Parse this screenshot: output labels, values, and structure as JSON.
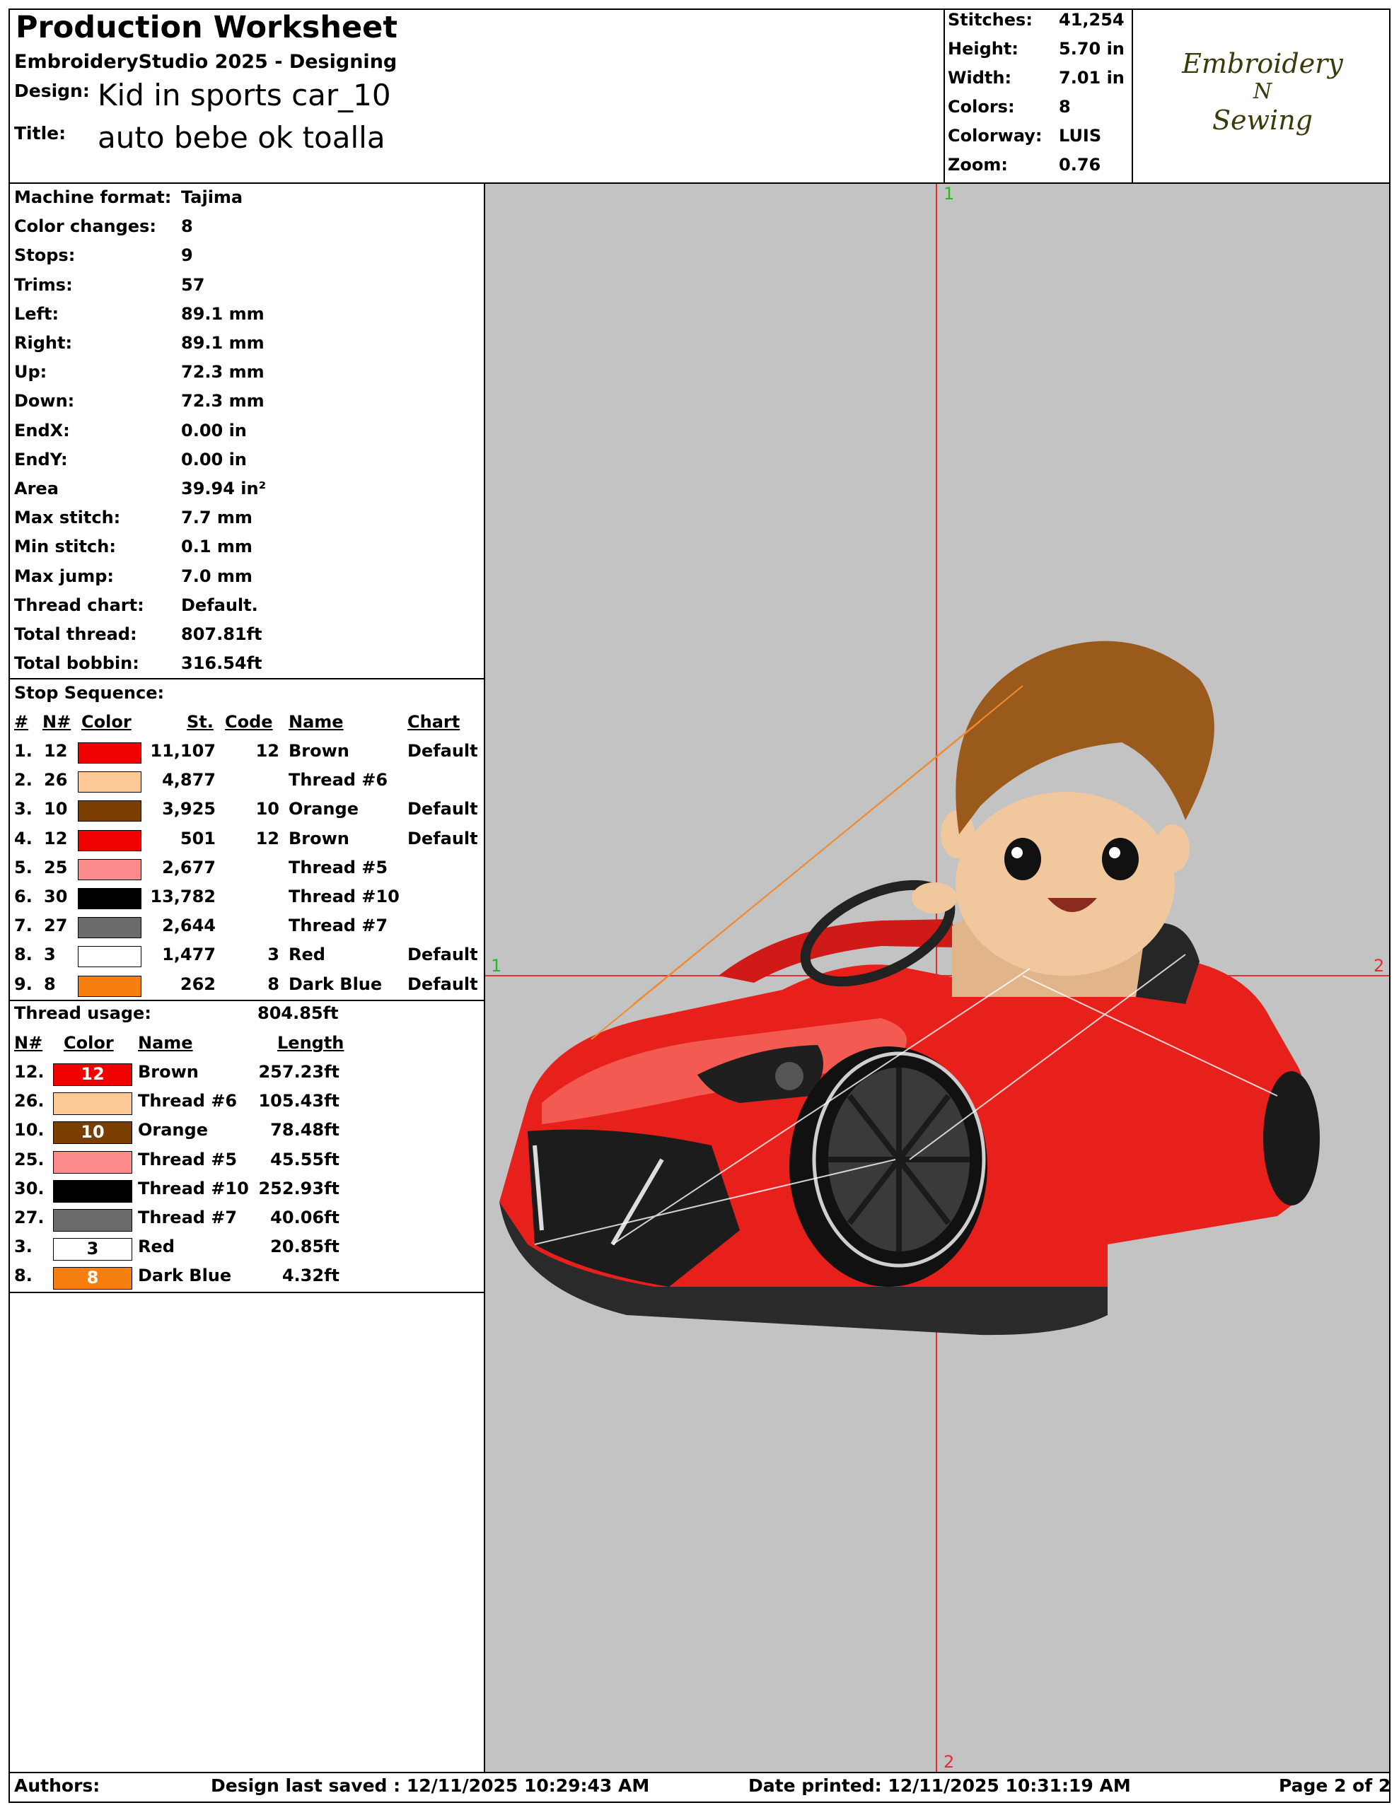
{
  "header": {
    "title": "Production Worksheet",
    "app": "EmbroideryStudio 2025 - Designing",
    "design_label": "Design:",
    "design_value": "Kid in sports car_10",
    "title_label": "Title:",
    "title_value": "auto bebe ok toalla"
  },
  "summary": [
    {
      "label": "Stitches:",
      "value": "41,254"
    },
    {
      "label": "Height:",
      "value": "5.70 in"
    },
    {
      "label": "Width:",
      "value": "7.01 in"
    },
    {
      "label": "Colors:",
      "value": "8"
    },
    {
      "label": "Colorway:",
      "value": "LUIS"
    },
    {
      "label": "Zoom:",
      "value": "0.76"
    }
  ],
  "logo": {
    "line1": "Embroidery",
    "line2": "N",
    "line3": "Sewing"
  },
  "info": [
    {
      "label": "Machine format:",
      "value": "Tajima"
    },
    {
      "label": "Color changes:",
      "value": "8"
    },
    {
      "label": "Stops:",
      "value": "9"
    },
    {
      "label": "Trims:",
      "value": "57"
    },
    {
      "label": "Left:",
      "value": "89.1 mm"
    },
    {
      "label": "Right:",
      "value": "89.1 mm"
    },
    {
      "label": "Up:",
      "value": "72.3 mm"
    },
    {
      "label": "Down:",
      "value": "72.3 mm"
    },
    {
      "label": "EndX:",
      "value": "0.00 in"
    },
    {
      "label": "EndY:",
      "value": "0.00 in"
    },
    {
      "label": "Area",
      "value": " 39.94 in²"
    },
    {
      "label": "Max stitch:",
      "value": "7.7 mm"
    },
    {
      "label": "Min stitch:",
      "value": "0.1 mm"
    },
    {
      "label": "Max jump:",
      "value": "7.0 mm"
    },
    {
      "label": "Thread chart:",
      "value": "Default."
    },
    {
      "label": "Total thread:",
      "value": "807.81ft"
    },
    {
      "label": "Total bobbin:",
      "value": "316.54ft"
    }
  ],
  "stop_sequence": {
    "title": "Stop Sequence:",
    "headers": {
      "idx": "#",
      "n": "N#",
      "color": "Color",
      "st": "St.",
      "code": "Code",
      "name": "Name",
      "chart": "Chart"
    },
    "rows": [
      {
        "idx": "1.",
        "n": "12",
        "color": "#f00000",
        "st": "11,107",
        "code": "12",
        "name": "Brown",
        "chart": "Default"
      },
      {
        "idx": "2.",
        "n": "26",
        "color": "#fcc896",
        "st": "4,877",
        "code": "",
        "name": "Thread #6",
        "chart": ""
      },
      {
        "idx": "3.",
        "n": "10",
        "color": "#7a3e00",
        "st": "3,925",
        "code": "10",
        "name": "Orange",
        "chart": "Default"
      },
      {
        "idx": "4.",
        "n": "12",
        "color": "#f00000",
        "st": "501",
        "code": "12",
        "name": "Brown",
        "chart": "Default"
      },
      {
        "idx": "5.",
        "n": "25",
        "color": "#fb8a8a",
        "st": "2,677",
        "code": "",
        "name": "Thread #5",
        "chart": ""
      },
      {
        "idx": "6.",
        "n": "30",
        "color": "#000000",
        "st": "13,782",
        "code": "",
        "name": "Thread #10",
        "chart": ""
      },
      {
        "idx": "7.",
        "n": "27",
        "color": "#6b6b6b",
        "st": "2,644",
        "code": "",
        "name": "Thread #7",
        "chart": ""
      },
      {
        "idx": "8.",
        "n": "3",
        "color": "#ffffff",
        "st": "1,477",
        "code": "3",
        "name": "Red",
        "chart": "Default"
      },
      {
        "idx": "9.",
        "n": "8",
        "color": "#f77f10",
        "st": "262",
        "code": "8",
        "name": "Dark Blue",
        "chart": "Default"
      }
    ]
  },
  "thread_usage": {
    "title": "Thread usage:",
    "total": "804.85ft",
    "headers": {
      "n": "N#",
      "color": "Color",
      "name": "Name",
      "length": "Length"
    },
    "rows": [
      {
        "n": "12.",
        "color": "#f00000",
        "num": "12",
        "text_color": "#ffffff",
        "name": "Brown",
        "length": "257.23ft"
      },
      {
        "n": "26.",
        "color": "#fcc896",
        "num": "",
        "text_color": "#000000",
        "name": "Thread #6",
        "length": "105.43ft"
      },
      {
        "n": "10.",
        "color": "#7a3e00",
        "num": "10",
        "text_color": "#ffffff",
        "name": "Orange",
        "length": "78.48ft"
      },
      {
        "n": "25.",
        "color": "#fb8a8a",
        "num": "",
        "text_color": "#000000",
        "name": "Thread #5",
        "length": "45.55ft"
      },
      {
        "n": "30.",
        "color": "#000000",
        "num": "",
        "text_color": "#ffffff",
        "name": "Thread #10",
        "length": "252.93ft"
      },
      {
        "n": "27.",
        "color": "#6b6b6b",
        "num": "",
        "text_color": "#ffffff",
        "name": "Thread #7",
        "length": "40.06ft"
      },
      {
        "n": "3.",
        "color": "#ffffff",
        "num": "3",
        "text_color": "#000000",
        "name": "Red",
        "length": "20.85ft"
      },
      {
        "n": "8.",
        "color": "#f77f10",
        "num": "8",
        "text_color": "#ffffff",
        "name": "Dark Blue",
        "length": "4.32ft"
      }
    ]
  },
  "preview": {
    "background": "#c3c3c3",
    "axis_color": "#e03030",
    "marker_color": "#22bb22",
    "marker_1": "1",
    "marker_2": "2"
  },
  "footer": {
    "authors": "Authors:",
    "saved": "Design last saved : 12/11/2025 10:29:43 AM",
    "printed": "Date printed: 12/11/2025 10:31:19 AM",
    "page": "Page 2 of 2"
  }
}
